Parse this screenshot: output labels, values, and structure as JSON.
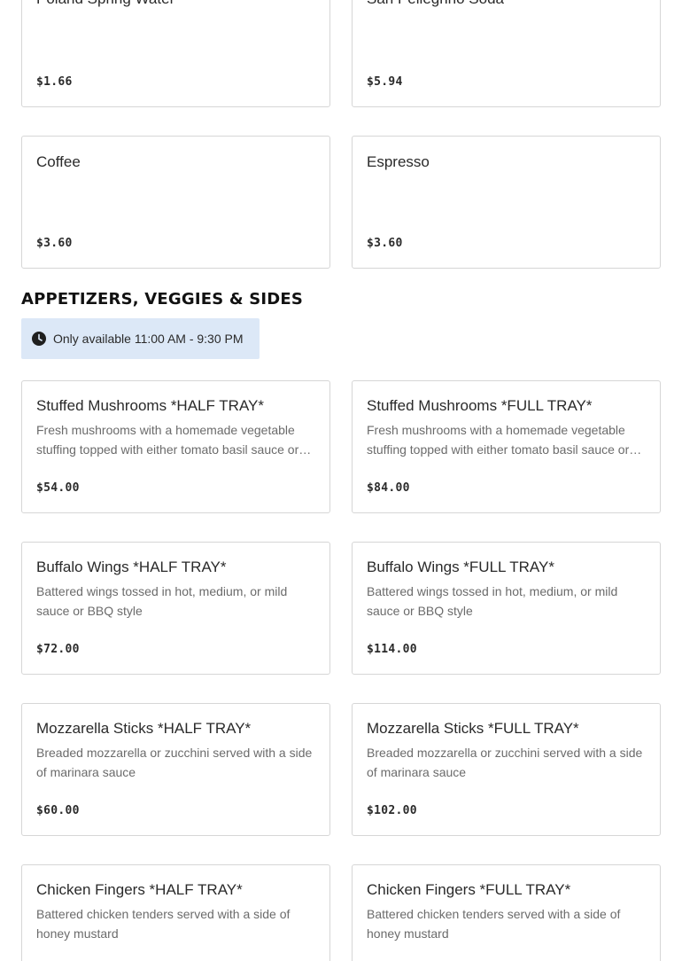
{
  "beverages": [
    {
      "name": "Poland Spring Water",
      "description": "",
      "price": "$1.66"
    },
    {
      "name": "San Pellegrino Soda",
      "description": "",
      "price": "$5.94"
    },
    {
      "name": "Coffee",
      "description": "",
      "price": "$3.60"
    },
    {
      "name": "Espresso",
      "description": "",
      "price": "$3.60"
    }
  ],
  "appetizers": {
    "title": "APPETIZERS, VEGGIES & SIDES",
    "availability": "Only available 11:00 AM - 9:30 PM",
    "availability_icon": "clock-icon",
    "items": [
      {
        "name": "Stuffed Mushrooms *HALF TRAY*",
        "description": "Fresh mushrooms with a homemade vegetable stuffing topped with either tomato basil sauce or garlic butter",
        "price": "$54.00"
      },
      {
        "name": "Stuffed Mushrooms *FULL TRAY*",
        "description": "Fresh mushrooms with a homemade vegetable stuffing topped with either tomato basil sauce or garlic butter",
        "price": "$84.00"
      },
      {
        "name": "Buffalo Wings *HALF TRAY*",
        "description": "Battered wings tossed in hot, medium, or mild sauce or BBQ style",
        "price": "$72.00"
      },
      {
        "name": "Buffalo Wings *FULL TRAY*",
        "description": "Battered wings tossed in hot, medium, or mild sauce or BBQ style",
        "price": "$114.00"
      },
      {
        "name": "Mozzarella Sticks *HALF TRAY*",
        "description": "Breaded mozzarella or zucchini served with a side of marinara sauce",
        "price": "$60.00"
      },
      {
        "name": "Mozzarella Sticks *FULL TRAY*",
        "description": "Breaded mozzarella or zucchini served with a side of marinara sauce",
        "price": "$102.00"
      },
      {
        "name": "Chicken Fingers *HALF TRAY*",
        "description": "Battered chicken tenders served with a side of honey mustard",
        "price": ""
      },
      {
        "name": "Chicken Fingers *FULL TRAY*",
        "description": "Battered chicken tenders served with a side of honey mustard",
        "price": ""
      }
    ]
  },
  "colors": {
    "availability_bg": "#dce8f7",
    "card_border": "#d6d6d6",
    "description_text": "#6b6b6b"
  }
}
